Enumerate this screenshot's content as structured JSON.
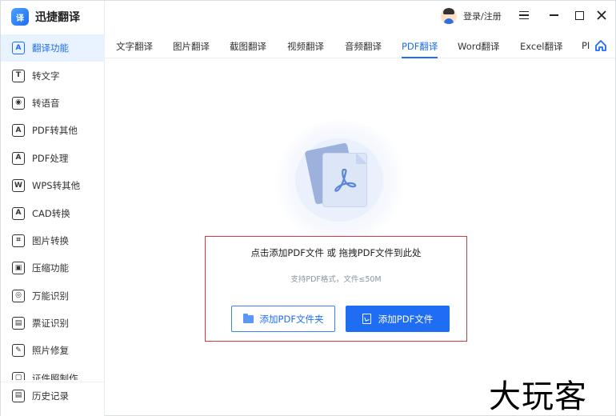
{
  "app": {
    "logo_glyph": "译",
    "name": "迅捷翻译"
  },
  "titlebar": {
    "login_label": "登录/注册"
  },
  "sidebar": {
    "items": [
      {
        "label": "翻译功能",
        "icon": "A",
        "icon_name": "translate-icon",
        "active": true
      },
      {
        "label": "转文字",
        "icon": "T",
        "icon_name": "text-convert-icon"
      },
      {
        "label": "转语音",
        "icon": "◉",
        "icon_name": "voice-icon"
      },
      {
        "label": "PDF转其他",
        "icon": "A",
        "icon_name": "pdf-convert-icon"
      },
      {
        "label": "PDF处理",
        "icon": "A",
        "icon_name": "pdf-process-icon"
      },
      {
        "label": "WPS转其他",
        "icon": "W",
        "icon_name": "wps-convert-icon"
      },
      {
        "label": "CAD转换",
        "icon": "A",
        "icon_name": "cad-convert-icon"
      },
      {
        "label": "图片转换",
        "icon": "⌗",
        "icon_name": "image-convert-icon"
      },
      {
        "label": "压缩功能",
        "icon": "▣",
        "icon_name": "compress-icon"
      },
      {
        "label": "万能识别",
        "icon": "◎",
        "icon_name": "ocr-icon"
      },
      {
        "label": "票证识别",
        "icon": "▤",
        "icon_name": "ticket-ocr-icon"
      },
      {
        "label": "照片修复",
        "icon": "✎",
        "icon_name": "photo-repair-icon"
      },
      {
        "label": "证件照制作",
        "icon": "▢",
        "icon_name": "id-photo-icon"
      }
    ],
    "history_label": "历史记录"
  },
  "tabs": [
    {
      "label": "文字翻译"
    },
    {
      "label": "图片翻译"
    },
    {
      "label": "截图翻译"
    },
    {
      "label": "视频翻译"
    },
    {
      "label": "音频翻译"
    },
    {
      "label": "PDF翻译",
      "active": true
    },
    {
      "label": "Word翻译"
    },
    {
      "label": "Excel翻译"
    },
    {
      "label": "PI"
    }
  ],
  "upload": {
    "title": "点击添加PDF文件 或 拖拽PDF文件到此处",
    "hint": "支持PDF格式，文件≤50M",
    "add_folder_label": "添加PDF文件夹",
    "add_file_label": "添加PDF文件"
  },
  "watermark": "大玩客",
  "colors": {
    "accent": "#1f6df2",
    "highlight_border": "#d9363e",
    "active_bg": "#e9f2ff"
  }
}
